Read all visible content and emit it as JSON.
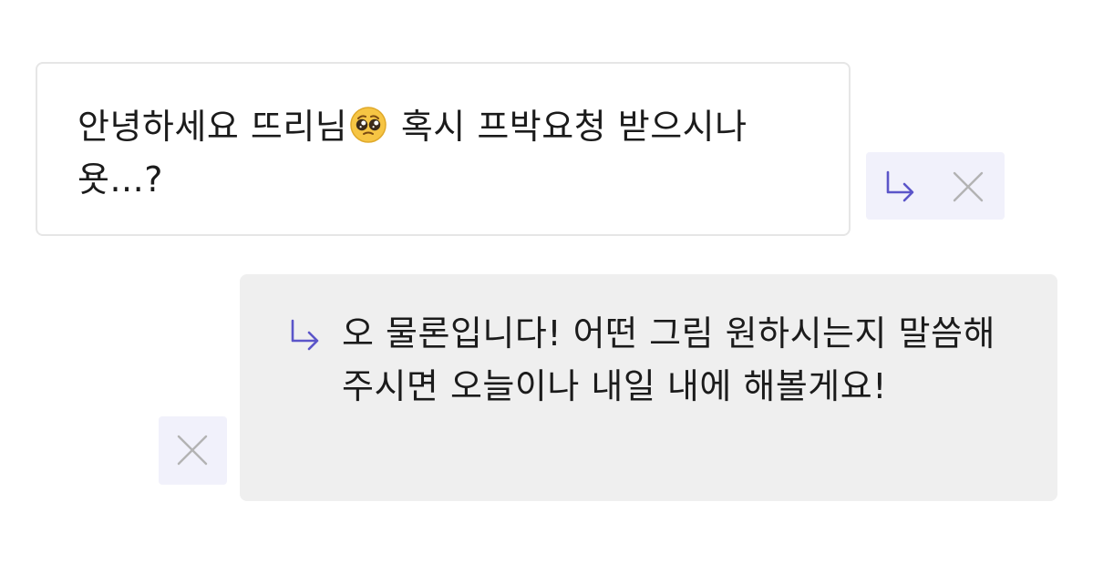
{
  "question": {
    "text_before_emoji": "안녕하세요 뜨리님",
    "emoji_name": "pleading-face-emoji",
    "text_after_emoji": " 혹시 프박요청 받으시나욧...?"
  },
  "answer": {
    "text": "오 물론입니다! 어떤 그림 원하시는지 말씀해주시면 오늘이나 내일 내에 해볼게요!"
  },
  "icons": {
    "reply": "reply-arrow-icon",
    "close": "close-icon"
  },
  "colors": {
    "accent": "#5b55c9",
    "icon_gray": "#b3b3b3",
    "action_bg": "#f1f1fb",
    "answer_bg": "#efefef",
    "card_border": "#e6e6e6"
  }
}
